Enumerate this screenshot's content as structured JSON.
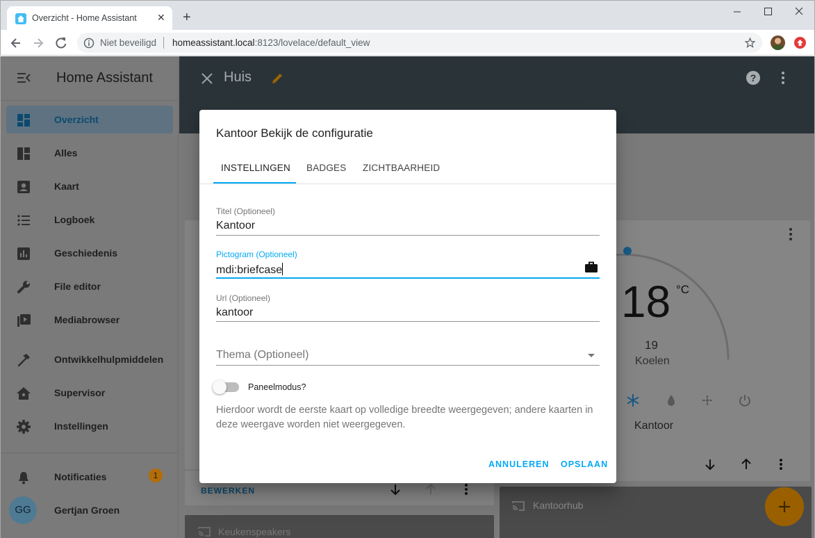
{
  "browser": {
    "tab_title": "Overzicht - Home Assistant",
    "security_label": "Niet beveiligd",
    "url_host": "homeassistant.local",
    "url_path": ":8123/lovelace/default_view"
  },
  "sidebar": {
    "title": "Home Assistant",
    "items": [
      {
        "label": "Overzicht",
        "icon": "view-dashboard-icon",
        "selected": true
      },
      {
        "label": "Alles",
        "icon": "view-dashboard-variant-icon"
      },
      {
        "label": "Kaart",
        "icon": "map-account-icon"
      },
      {
        "label": "Logboek",
        "icon": "format-list-bulleted-icon"
      },
      {
        "label": "Geschiedenis",
        "icon": "chart-box-icon"
      },
      {
        "label": "File editor",
        "icon": "wrench-icon"
      },
      {
        "label": "Mediabrowser",
        "icon": "play-box-multiple-icon"
      },
      {
        "label": "Ontwikkelhulpmiddelen",
        "icon": "hammer-icon"
      },
      {
        "label": "Supervisor",
        "icon": "home-assistant-icon"
      },
      {
        "label": "Instellingen",
        "icon": "cog-icon"
      }
    ],
    "notifications": {
      "label": "Notificaties",
      "count": "1"
    },
    "user": {
      "initials": "GG",
      "name": "Gertjan Groen"
    }
  },
  "toolbar": {
    "title": "Huis"
  },
  "background": {
    "thermostat": {
      "temperature": "18",
      "unit": "°C",
      "target": "19",
      "mode": "Koelen",
      "name": "Kantoor"
    },
    "edit_label": "BEWERKEN",
    "card_kitchen": "Keukenspeakers",
    "card_office_hub": "Kantoorhub"
  },
  "dialog": {
    "title": "Kantoor Bekijk de configuratie",
    "tabs": [
      "INSTELLINGEN",
      "BADGES",
      "ZICHTBAARHEID"
    ],
    "fields": {
      "title": {
        "label": "Titel (Optioneel)",
        "value": "Kantoor"
      },
      "icon": {
        "label": "Pictogram (Optioneel)",
        "value": "mdi:briefcase"
      },
      "url": {
        "label": "Url (Optioneel)",
        "value": "kantoor"
      },
      "theme": {
        "placeholder": "Thema (Optioneel)"
      }
    },
    "panel_mode": {
      "label": "Paneelmodus?",
      "enabled": false
    },
    "description": "Hierdoor wordt de eerste kaart op volledige breedte weergegeven; andere kaarten in deze weergave worden niet weergegeven.",
    "cancel_label": "ANNULEREN",
    "save_label": "OPSLAAN"
  },
  "colors": {
    "accent": "#03a9f4",
    "toolbar": "#2a3338",
    "badge": "#b36d06",
    "fab": "#9a6000"
  }
}
